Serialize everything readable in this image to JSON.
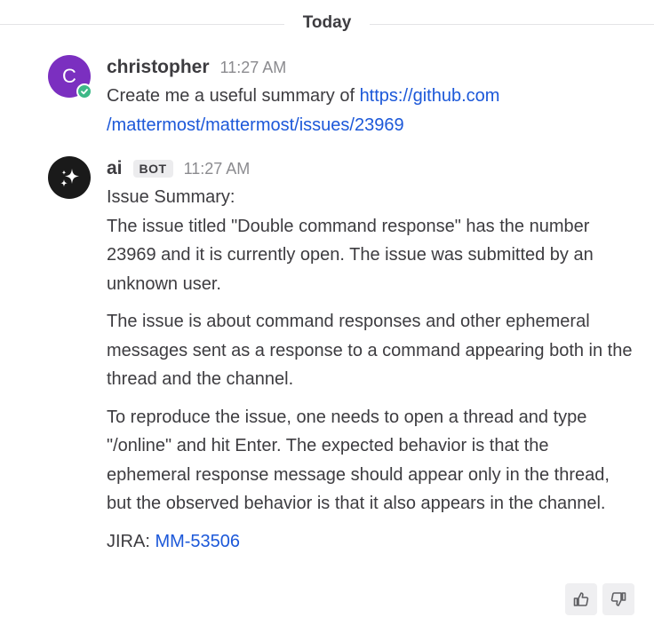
{
  "date_separator": "Today",
  "posts": [
    {
      "avatar_letter": "C",
      "username": "christopher",
      "time": "11:27 AM",
      "message_prefix": "Create me a useful summary of ",
      "link_part1": "https://github.com",
      "link_part2": "/mattermost/mattermost/issues/23969"
    },
    {
      "username": "ai",
      "badge": "BOT",
      "time": "11:27 AM",
      "heading": "Issue Summary:",
      "paragraph1": "The issue titled \"Double command response\" has the number 23969 and it is currently open. The issue was submitted by an unknown user.",
      "paragraph2": "The issue is about command responses and other ephemeral messages sent as a response to a command appearing both in the thread and the channel.",
      "paragraph3": "To reproduce the issue, one needs to open a thread and type \"/online\" and hit Enter. The expected behavior is that the ephemeral response message should appear only in the thread, but the observed behavior is that it also appears in the channel.",
      "jira_label": "JIRA: ",
      "jira_link": "MM-53506"
    }
  ],
  "icons": {
    "status": "check-circle-icon",
    "bot_avatar": "sparkle-icon",
    "thumbs_up": "thumbs-up-icon",
    "thumbs_down": "thumbs-down-icon"
  },
  "colors": {
    "user_avatar": "#7b2fc0",
    "status_online": "#3db887",
    "link": "#1c58d9",
    "bot_avatar": "#1a1a1a"
  }
}
